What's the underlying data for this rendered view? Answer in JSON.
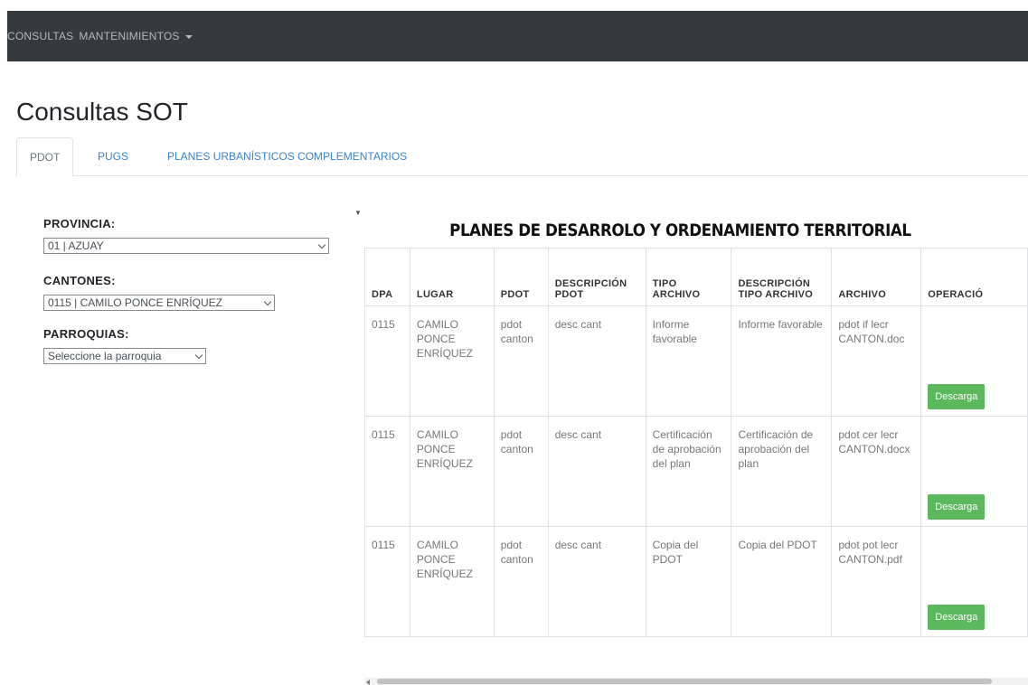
{
  "navbar": {
    "items": [
      {
        "label": "CONSULTAS"
      },
      {
        "label": "MANTENIMIENTOS"
      }
    ]
  },
  "page": {
    "title": "Consultas SOT"
  },
  "tabs": [
    {
      "label": "PDOT",
      "active": true
    },
    {
      "label": "PUGS",
      "active": false
    },
    {
      "label": "PLANES URBANÍSTICOS COMPLEMENTARIOS",
      "active": false
    }
  ],
  "filters": {
    "provincia": {
      "label": "PROVINCIA:",
      "value": "01 | AZUAY"
    },
    "cantones": {
      "label": "CANTONES:",
      "value": "0115 | CAMILO PONCE ENRÍQUEZ"
    },
    "parroquias": {
      "label": "PARROQUIAS:",
      "value": "Seleccione la parroquia"
    }
  },
  "table": {
    "heading": "PLANES DE DESARROLO Y ORDENAMIENTO TERRITORIAL",
    "columns": [
      "DPA",
      "LUGAR",
      "PDOT",
      "DESCRIPCIÓN PDOT",
      "TIPO ARCHIVO",
      "DESCRIPCIÓN TIPO ARCHIVO",
      "ARCHIVO",
      "OPERACIÓ"
    ],
    "rows": [
      {
        "dpa": "0115",
        "lugar": "CAMILO PONCE ENRÍQUEZ",
        "pdot": "pdot canton",
        "descripcion_pdot": "desc cant",
        "tipo_archivo": "Informe favorable",
        "descripcion_tipo": "Informe favorable",
        "archivo": "pdot if lecr CANTON.doc",
        "action": "Descarga"
      },
      {
        "dpa": "0115",
        "lugar": "CAMILO PONCE ENRÍQUEZ",
        "pdot": "pdot canton",
        "descripcion_pdot": "desc cant",
        "tipo_archivo": "Certificación de aprobación del plan",
        "descripcion_tipo": "Certificación de aprobación del plan",
        "archivo": "pdot cer lecr CANTON.docx",
        "action": "Descarga"
      },
      {
        "dpa": "0115",
        "lugar": "CAMILO PONCE ENRÍQUEZ",
        "pdot": "pdot canton",
        "descripcion_pdot": "desc cant",
        "tipo_archivo": "Copia del PDOT",
        "descripcion_tipo": "Copia del PDOT",
        "archivo": "pdot pot lecr CANTON.pdf",
        "action": "Descarga"
      }
    ]
  },
  "colors": {
    "navbar_bg": "#343a40",
    "link": "#3a83d1",
    "success_button": "#5cb85c"
  }
}
